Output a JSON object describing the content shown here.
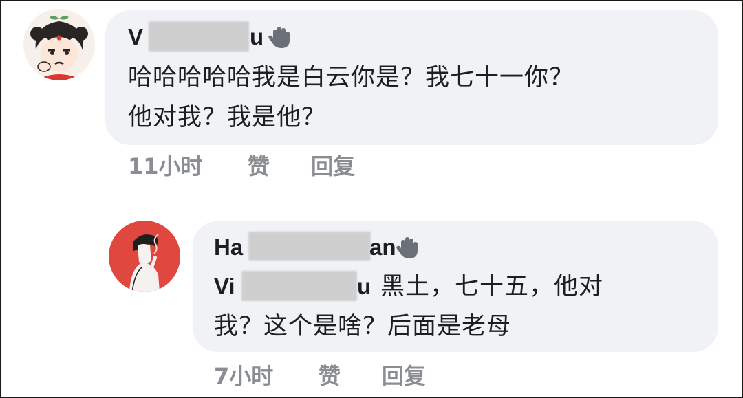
{
  "comments": [
    {
      "author_visible_start": "V",
      "author_visible_end": "u",
      "text_line1": "哈哈哈哈哈我是白云你是？我七十一你？",
      "text_line2": "他对我？我是他？",
      "time": "11小时",
      "like_label": "赞",
      "reply_label": "回复"
    },
    {
      "author_visible_start": "Ha",
      "author_visible_end": "an",
      "mention_visible_start": "Vi",
      "mention_visible_end": "u",
      "text_line1_rest": "黑土，七十五，他对",
      "text_line2": "我？这个是啥？后面是老母",
      "time": "7小时",
      "like_label": "赞",
      "reply_label": "回复"
    }
  ],
  "icons": {
    "badge": "waving-hand-icon",
    "avatar1": "cartoon-girl-avatar",
    "avatar2": "smoking-boy-avatar"
  },
  "colors": {
    "bubble": "#f0f2f5",
    "meta_text": "#8a8d91",
    "avatar2_bg": "#e0473f"
  }
}
